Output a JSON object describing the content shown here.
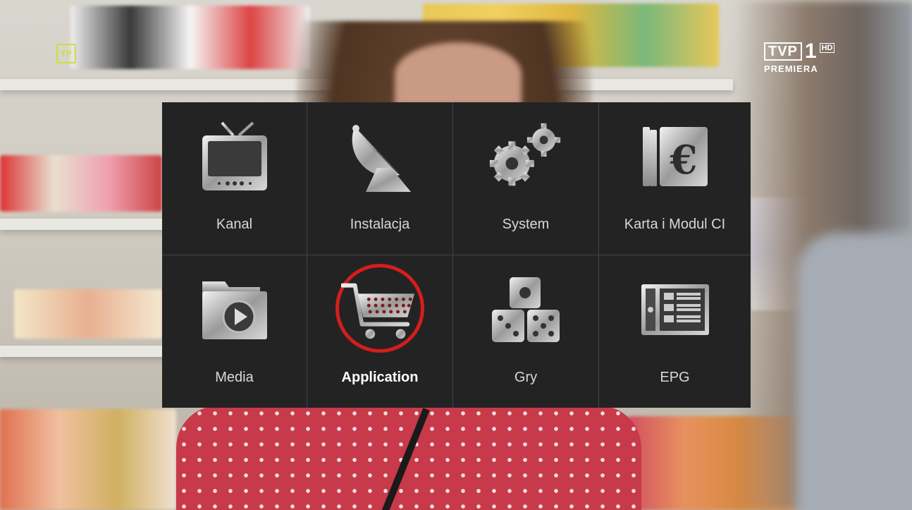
{
  "window": {
    "title": ""
  },
  "channel": {
    "logo_text": "TVP",
    "number": "1",
    "hd_badge": "HD",
    "sub": "PREMIERA",
    "corner_badge": "TP"
  },
  "menu": {
    "selected": "Application",
    "items": [
      {
        "label": "Kanal",
        "icon": "tv-icon"
      },
      {
        "label": "Instalacja",
        "icon": "satellite-dish-icon"
      },
      {
        "label": "System",
        "icon": "gears-icon"
      },
      {
        "label": "Karta i Modul CI",
        "icon": "euro-card-icon"
      },
      {
        "label": "Media",
        "icon": "media-folder-icon"
      },
      {
        "label": "Application",
        "icon": "shopping-cart-icon"
      },
      {
        "label": "Gry",
        "icon": "dice-icon"
      },
      {
        "label": "EPG",
        "icon": "epg-guide-icon"
      }
    ]
  },
  "colors": {
    "panel": "#232323",
    "grid_line": "#3c4650",
    "highlight_ring": "#d51d1d",
    "icon_metal": "#c9c9c9"
  }
}
